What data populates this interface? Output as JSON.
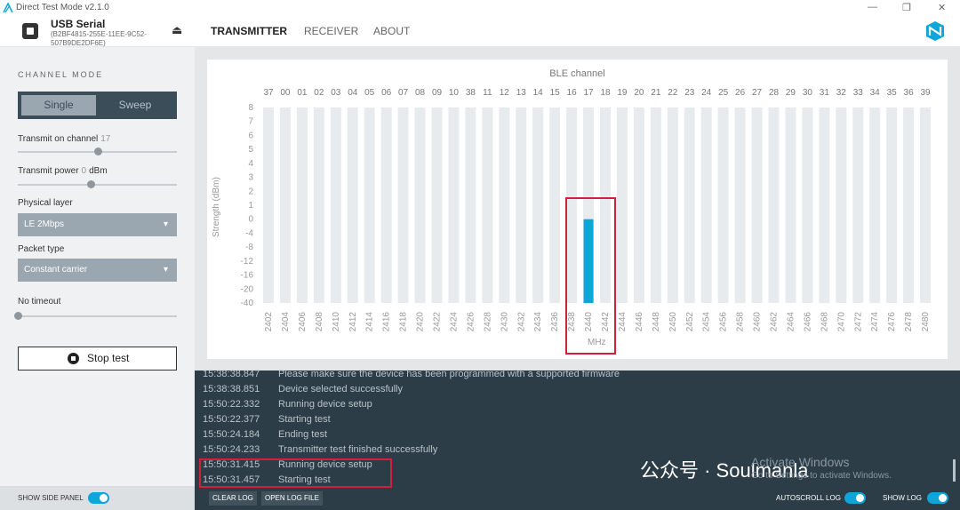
{
  "window": {
    "title": "Direct Test Mode v2.1.0",
    "controls": [
      "—",
      "❐",
      "✕"
    ]
  },
  "device": {
    "name": "USB Serial",
    "serial": "(B2BF4815-255E-11EE-9C52-507B9DE2DF6E)",
    "eject_icon": "⏏"
  },
  "tabs": [
    "TRANSMITTER",
    "RECEIVER",
    "ABOUT"
  ],
  "sidebar": {
    "section_title": "CHANNEL MODE",
    "mode_single": "Single",
    "mode_sweep": "Sweep",
    "transmit_channel_label": "Transmit on channel",
    "transmit_channel_value": "17",
    "transmit_channel_level": 0.5,
    "transmit_power_label": "Transmit power",
    "transmit_power_value": "0",
    "transmit_power_unit": "dBm",
    "transmit_power_level": 0.46,
    "physical_layer_label": "Physical layer",
    "physical_layer_value": "LE 2Mbps",
    "packet_type_label": "Packet type",
    "packet_type_value": "Constant carrier",
    "timeout_label": "No timeout",
    "timeout_level": 0,
    "stop_label": "Stop test"
  },
  "bottom": {
    "show_side_panel": "SHOW SIDE PANEL",
    "clear_log": "CLEAR LOG",
    "open_log_file": "OPEN LOG FILE",
    "autoscroll_log": "AUTOSCROLL LOG",
    "show_log": "SHOW LOG"
  },
  "log": [
    {
      "time": "15:38:38.847",
      "message": "Please make sure the device has been programmed with a supported firmware"
    },
    {
      "time": "15:38:38.851",
      "message": "Device selected successfully"
    },
    {
      "time": "15:50:22.332",
      "message": "Running device setup"
    },
    {
      "time": "15:50:22.377",
      "message": "Starting test"
    },
    {
      "time": "15:50:24.184",
      "message": "Ending test"
    },
    {
      "time": "15:50:24.233",
      "message": "Transmitter test finished successfully"
    },
    {
      "time": "15:50:31.415",
      "message": "Running device setup"
    },
    {
      "time": "15:50:31.457",
      "message": "Starting test"
    }
  ],
  "watermark": {
    "line1": "Activate Windows",
    "line2": "Go to Settings to activate Windows.",
    "wechat": "公众号 · Soulmanla"
  },
  "colors": {
    "accent": "#0ea5d9",
    "bar_bg": "#e8ebed",
    "sidebar_dark": "#3c4d5a",
    "highlight": "#d21f3c"
  },
  "chart_data": {
    "type": "bar",
    "title": "BLE channel",
    "xlabel": "MHz",
    "ylabel": "Strength (dBm)",
    "ylim": [
      -40,
      8
    ],
    "yticks": [
      "8",
      "7",
      "6",
      "5",
      "4",
      "3",
      "2",
      "1",
      "0",
      "-4",
      "-8",
      "-12",
      "-16",
      "-20",
      "-40"
    ],
    "channels": [
      "37",
      "00",
      "01",
      "02",
      "03",
      "04",
      "05",
      "06",
      "07",
      "08",
      "09",
      "10",
      "38",
      "11",
      "12",
      "13",
      "14",
      "15",
      "16",
      "17",
      "18",
      "19",
      "20",
      "21",
      "22",
      "23",
      "24",
      "25",
      "26",
      "27",
      "28",
      "29",
      "30",
      "31",
      "32",
      "33",
      "34",
      "35",
      "36",
      "39"
    ],
    "frequencies": [
      "2402",
      "2404",
      "2406",
      "2408",
      "2410",
      "2412",
      "2414",
      "2416",
      "2418",
      "2420",
      "2422",
      "2424",
      "2426",
      "2428",
      "2430",
      "2432",
      "2434",
      "2436",
      "2438",
      "2440",
      "2442",
      "2444",
      "2446",
      "2448",
      "2450",
      "2452",
      "2454",
      "2456",
      "2458",
      "2460",
      "2462",
      "2464",
      "2466",
      "2468",
      "2470",
      "2472",
      "2474",
      "2476",
      "2478",
      "2480"
    ],
    "series": [
      {
        "name": "",
        "active_index": 19,
        "value": 0
      }
    ]
  }
}
